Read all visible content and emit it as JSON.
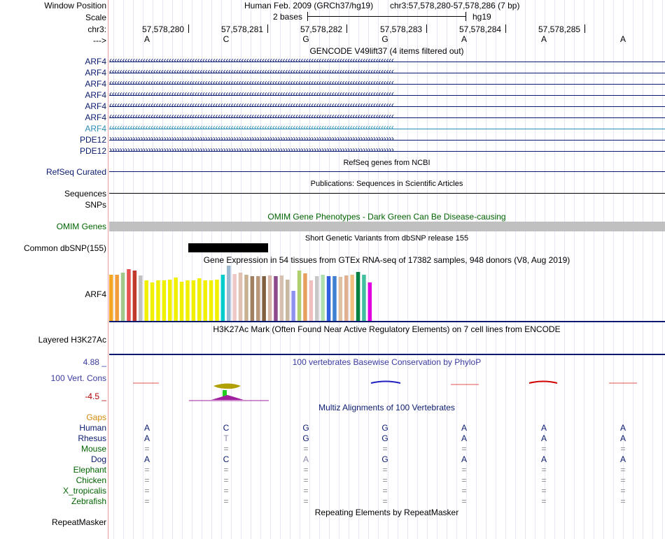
{
  "header": {
    "window_position_label": "Window Position",
    "scale_label": "Scale",
    "chrom_label": "chr3:",
    "strand_label": "--->",
    "assembly_text": "Human Feb. 2009 (GRCh37/hg19)",
    "position_text": "chr3:57,578,280-57,578,286 (7 bp)",
    "scale_text": "2 bases",
    "db_text": "hg19",
    "coordinates": [
      "57,578,280",
      "57,578,281",
      "57,578,282",
      "57,578,283",
      "57,578,284",
      "57,578,285"
    ],
    "bases": [
      "A",
      "C",
      "G",
      "G",
      "A",
      "A",
      "A"
    ]
  },
  "gencode": {
    "title": "GENCODE V49lift37 (4 items filtered out)",
    "items": [
      "ARF4",
      "ARF4",
      "ARF4",
      "ARF4",
      "ARF4",
      "ARF4",
      "ARF4",
      "PDE12",
      "PDE12"
    ]
  },
  "refseq": {
    "label": "RefSeq Curated",
    "title": "RefSeq genes from NCBI"
  },
  "sequences": {
    "label": "Sequences",
    "title": "Publications: Sequences in Scientific Articles"
  },
  "snps": {
    "label": "SNPs"
  },
  "omim": {
    "label": "OMIM Genes",
    "title": "OMIM Gene Phenotypes - Dark Green Can Be Disease-causing"
  },
  "common_dbsnp": {
    "label": "Common dbSNP(155)",
    "title": "Short Genetic Variants from dbSNP release 155"
  },
  "gtex": {
    "title": "Gene Expression in 54 tissues from GTEx RNA-seq of 17382 samples, 948 donors (V8, Aug 2019)",
    "gene_label": "ARF4",
    "colors": [
      "#f5a623",
      "#f39c3c",
      "#a3c98a",
      "#e85050",
      "#c0392b",
      "#c0c0c0",
      "#f0f000",
      "#f0f000",
      "#f0f000",
      "#f0f000",
      "#f0f000",
      "#f0f000",
      "#f0f000",
      "#f0f000",
      "#f0f000",
      "#f0f000",
      "#f0f000",
      "#f0f000",
      "#f0f000",
      "#00cccc",
      "#9ab8d0",
      "#eec8c8",
      "#e0c0b0",
      "#c8b090",
      "#a08060",
      "#b89878",
      "#806040",
      "#d8b8a8",
      "#8b4a8b",
      "#d8c0b0",
      "#c8b8a0",
      "#9090f0",
      "#b0d070",
      "#e8a060",
      "#f0c0c0",
      "#c8c8c8",
      "#b0e0b0",
      "#3060e0",
      "#4080d0",
      "#e0c0a0",
      "#e0b090",
      "#f0c080",
      "#008040",
      "#40c0a0",
      "#e000e0"
    ],
    "values": [
      0.84,
      0.84,
      0.87,
      0.94,
      0.91,
      0.82,
      0.74,
      0.7,
      0.73,
      0.73,
      0.75,
      0.79,
      0.71,
      0.74,
      0.73,
      0.77,
      0.74,
      0.73,
      0.75,
      0.83,
      1.0,
      0.85,
      0.87,
      0.84,
      0.81,
      0.81,
      0.81,
      0.82,
      0.81,
      0.82,
      0.75,
      0.55,
      0.91,
      0.86,
      0.73,
      0.81,
      0.84,
      0.81,
      0.81,
      0.8,
      0.82,
      0.84,
      0.88,
      0.84,
      0.7
    ]
  },
  "h3k27ac": {
    "label": "Layered H3K27Ac",
    "title": "H3K27Ac Mark (Often Found Near Active Regulatory Elements) on 7 cell lines from ENCODE"
  },
  "phylop": {
    "label": "100 Vert. Cons",
    "max_label": "4.88 _",
    "min_label": "-4.5 _",
    "title": "100 vertebrates Basewise Conservation by PhyloP"
  },
  "multiz": {
    "title": "Multiz Alignments of 100 Vertebrates",
    "gaps_label": "Gaps",
    "species": [
      {
        "name": "Human",
        "bases": [
          "A",
          "C",
          "G",
          "G",
          "A",
          "A",
          "A"
        ]
      },
      {
        "name": "Rhesus",
        "bases": [
          "A",
          "T",
          "G",
          "G",
          "A",
          "A",
          "A"
        ]
      },
      {
        "name": "Mouse",
        "bases": [
          "=",
          "=",
          "=",
          "=",
          "=",
          "=",
          "="
        ]
      },
      {
        "name": "Dog",
        "bases": [
          "A",
          "C",
          "A",
          "G",
          "A",
          "A",
          "A"
        ]
      },
      {
        "name": "Elephant",
        "bases": [
          "=",
          "=",
          "=",
          "=",
          "=",
          "=",
          "="
        ]
      },
      {
        "name": "Chicken",
        "bases": [
          "=",
          "=",
          "=",
          "=",
          "=",
          "=",
          "="
        ]
      },
      {
        "name": "X_tropicalis",
        "bases": [
          "=",
          "=",
          "=",
          "=",
          "=",
          "=",
          "="
        ]
      },
      {
        "name": "Zebrafish",
        "bases": [
          "=",
          "=",
          "=",
          "=",
          "=",
          "=",
          "="
        ]
      }
    ]
  },
  "repeatmasker": {
    "label": "RepeatMasker",
    "title": "Repeating Elements by RepeatMasker"
  },
  "colors": {
    "gene_navy": "#0a1a6e",
    "gene_light": "#2b8bb0",
    "omim_green": "#006400",
    "gaps_orange": "#d4890a",
    "phylop_blue": "#3a3aa0",
    "phylop_red": "#b00000",
    "gray_bar": "#c0c0c0"
  }
}
